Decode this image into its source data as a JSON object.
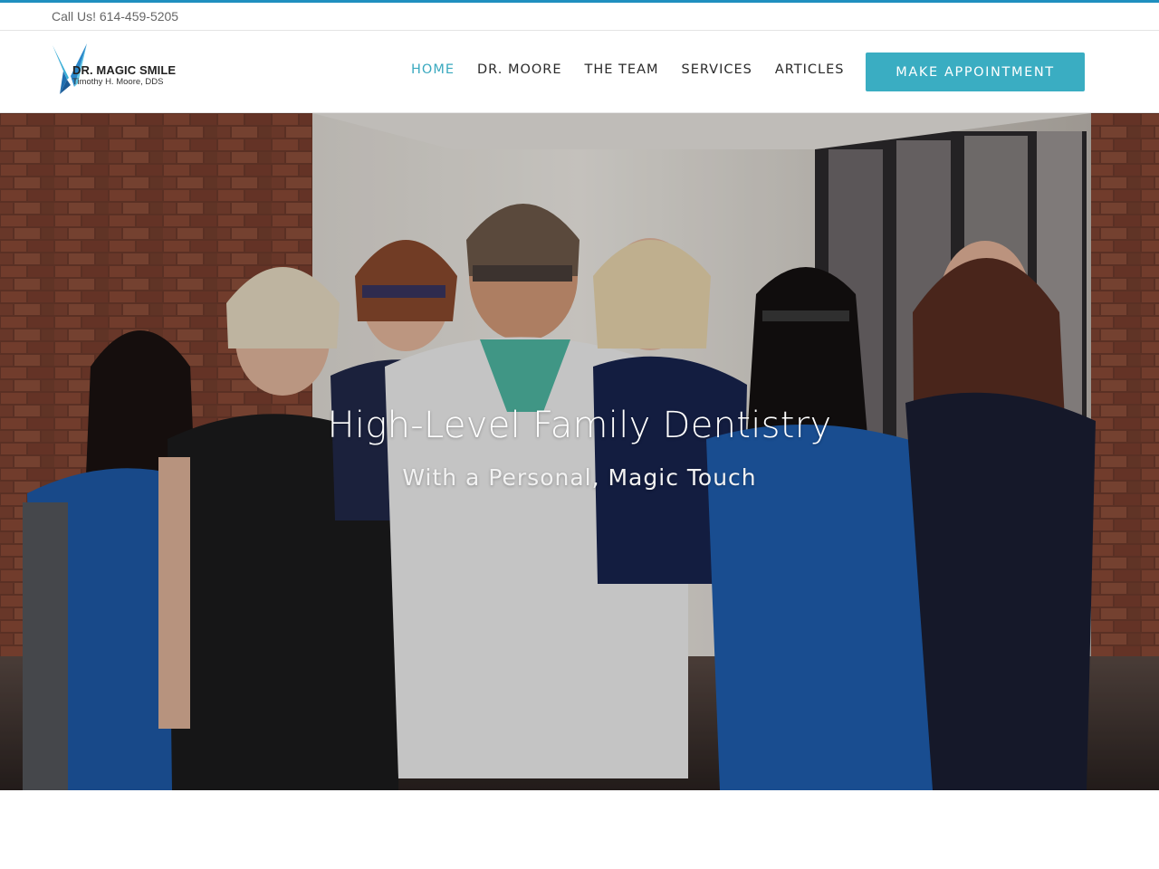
{
  "topbar": {
    "call_text": "Call Us! 614-459-5205"
  },
  "logo": {
    "name": "DR. MAGIC SMILE",
    "subtitle": "Timothy H. Moore, DDS",
    "icon": "logo-mark-icon"
  },
  "nav": {
    "items": [
      {
        "label": "HOME",
        "active": true
      },
      {
        "label": "DR. MOORE",
        "active": false
      },
      {
        "label": "THE TEAM",
        "active": false
      },
      {
        "label": "SERVICES",
        "active": false
      },
      {
        "label": "ARTICLES",
        "active": false
      }
    ],
    "cta_label": "MAKE APPOINTMENT"
  },
  "hero": {
    "headline": "High-Level Family Dentistry",
    "subline": "With a Personal, Magic Touch",
    "image": "team-photo"
  },
  "colors": {
    "accent": "#3aadc2",
    "active_nav": "#3aa9bf",
    "top_accent": "#1f8fbf"
  }
}
